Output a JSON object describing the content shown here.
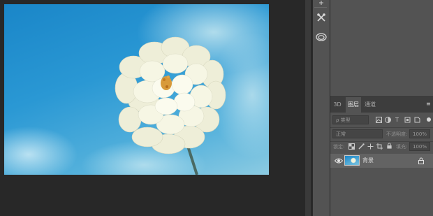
{
  "document": {
    "image": "flower-photo"
  },
  "colors": {
    "workspace_bg": "#282828",
    "panel_bg": "#535353",
    "tabbar_bg": "#3d3d3d",
    "selected_layer_bg": "#636363",
    "canvas_sky": "#2a98d4",
    "flower_petals": "#f4f3dc"
  },
  "side_tools": [
    {
      "icon": "tool-presets-icon"
    },
    {
      "icon": "brush-settings-icon"
    },
    {
      "icon": "creative-cloud-libraries-icon"
    }
  ],
  "layers_panel": {
    "tabs": [
      {
        "label": "3D",
        "active": false
      },
      {
        "label": "图层",
        "active": true
      },
      {
        "label": "通道",
        "active": false
      }
    ],
    "filter_placeholder": "ρ 类型",
    "filter_icons": [
      "image-filter-icon",
      "adjustment-filter-icon",
      "type-filter-icon",
      "shape-filter-icon",
      "smart-object-filter-icon"
    ],
    "blend_mode": "正常",
    "opacity_label": "不透明度:",
    "opacity_value": "100%",
    "lock_label": "锁定:",
    "lock_icons": [
      "lock-transparent-icon",
      "lock-pixels-icon",
      "lock-position-icon",
      "lock-artboard-icon",
      "lock-all-icon"
    ],
    "fill_label": "填充:",
    "fill_value": "100%",
    "layers": [
      {
        "name": "背景",
        "visible": true,
        "locked": true,
        "selected": true
      }
    ]
  }
}
